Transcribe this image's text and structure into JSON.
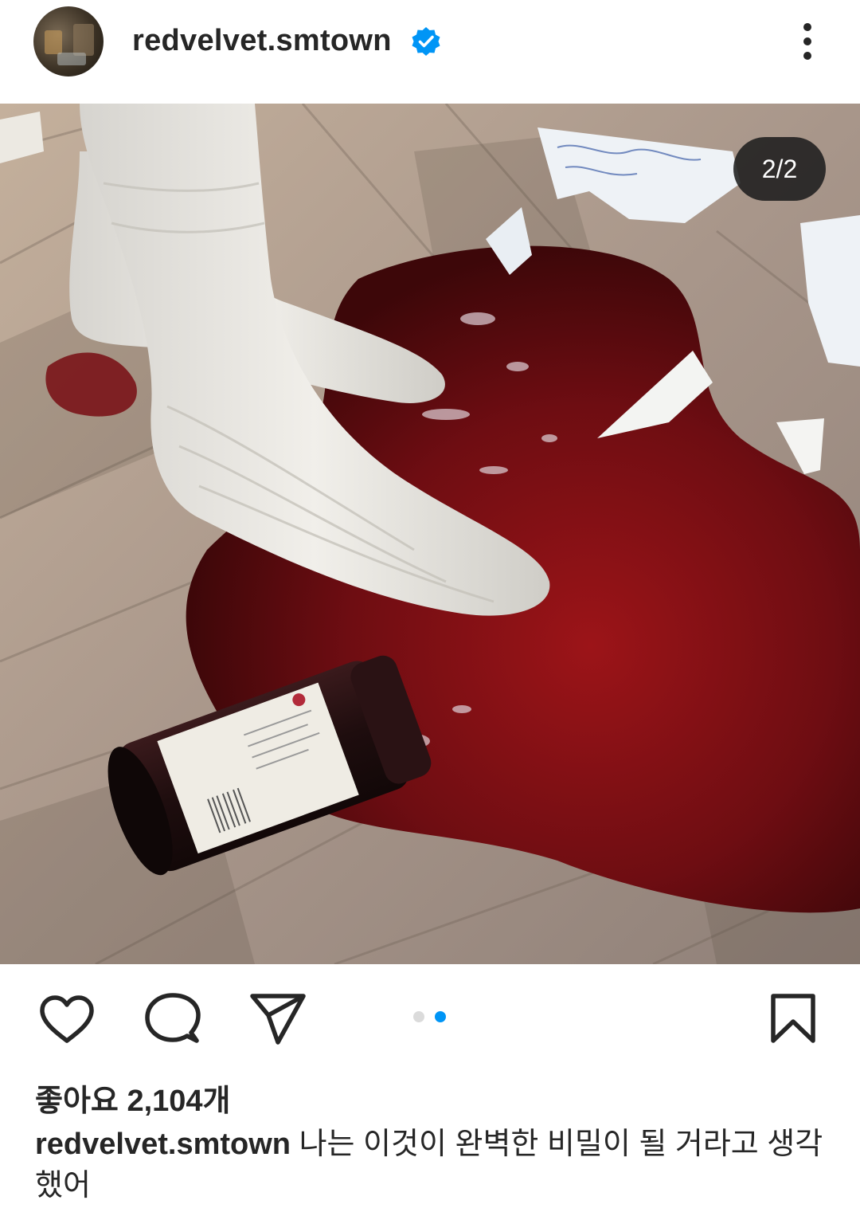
{
  "post": {
    "username": "redvelvet.smtown",
    "verified": true,
    "image_counter": "2/2",
    "likes": "좋아요 2,104개",
    "caption_username": "redvelvet.smtown",
    "caption_text": "나는 이것이 완벽한 비밀이 될 거라고 생각했어"
  },
  "icons": {
    "header": [
      "avatar",
      "verified-badge-icon",
      "more-options-icon"
    ],
    "actions": [
      "heart-icon",
      "comment-icon",
      "share-icon",
      "bookmark-icon"
    ]
  },
  "colors": {
    "accent_blue": "#0095f6",
    "text": "#262626",
    "dot_inactive": "#dbdbdb"
  },
  "carousel": {
    "total": 2,
    "active_index": 1
  }
}
